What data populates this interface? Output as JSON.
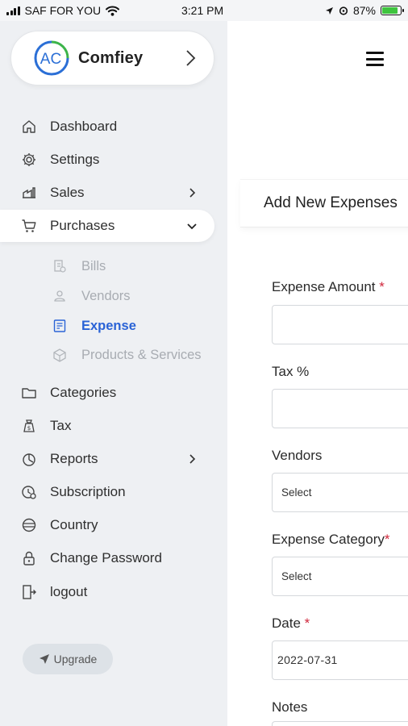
{
  "status_bar": {
    "carrier": "SAF FOR YOU",
    "time": "3:21 PM",
    "battery_text": "87%",
    "battery_level": 0.87
  },
  "sidebar": {
    "brand": {
      "logo_text": "AC",
      "name": "Comfiey"
    },
    "items": [
      {
        "label": "Dashboard",
        "icon": "home-icon"
      },
      {
        "label": "Settings",
        "icon": "gear-icon"
      },
      {
        "label": "Sales",
        "icon": "sales-icon",
        "has_chevron": true
      },
      {
        "label": "Purchases",
        "icon": "cart-icon",
        "expanded": true
      },
      {
        "label": "Categories",
        "icon": "folder-icon"
      },
      {
        "label": "Tax",
        "icon": "tax-icon"
      },
      {
        "label": "Reports",
        "icon": "reports-icon",
        "has_chevron": true
      },
      {
        "label": "Subscription",
        "icon": "subscription-icon"
      },
      {
        "label": "Country",
        "icon": "globe-icon"
      },
      {
        "label": "Change Password",
        "icon": "lock-icon"
      },
      {
        "label": "logout",
        "icon": "logout-icon"
      }
    ],
    "purchases_sub": [
      {
        "label": "Bills",
        "icon": "bills-icon"
      },
      {
        "label": "Vendors",
        "icon": "vendors-icon"
      },
      {
        "label": "Expense",
        "icon": "expense-icon",
        "active": true
      },
      {
        "label": "Products & Services",
        "icon": "products-icon"
      }
    ],
    "upgrade_label": "Upgrade"
  },
  "main": {
    "card_title": "Add New Expenses",
    "fields": {
      "amount": {
        "label": "Expense Amount",
        "required_mark": "*",
        "value": ""
      },
      "tax": {
        "label": "Tax %",
        "value": ""
      },
      "vendors": {
        "label": "Vendors",
        "value": "Select"
      },
      "category": {
        "label": "Expense Category",
        "required_mark": "*",
        "value": "Select"
      },
      "date": {
        "label": "Date",
        "required_mark": "*",
        "value": "2022-07-31"
      },
      "notes": {
        "label": "Notes",
        "value": ""
      }
    }
  },
  "colors": {
    "accent": "#2a63d6",
    "required": "#d0283c",
    "sidebar_bg": "#eef0f3",
    "logo_green": "#3cb44a",
    "logo_blue": "#2b6fd6"
  }
}
